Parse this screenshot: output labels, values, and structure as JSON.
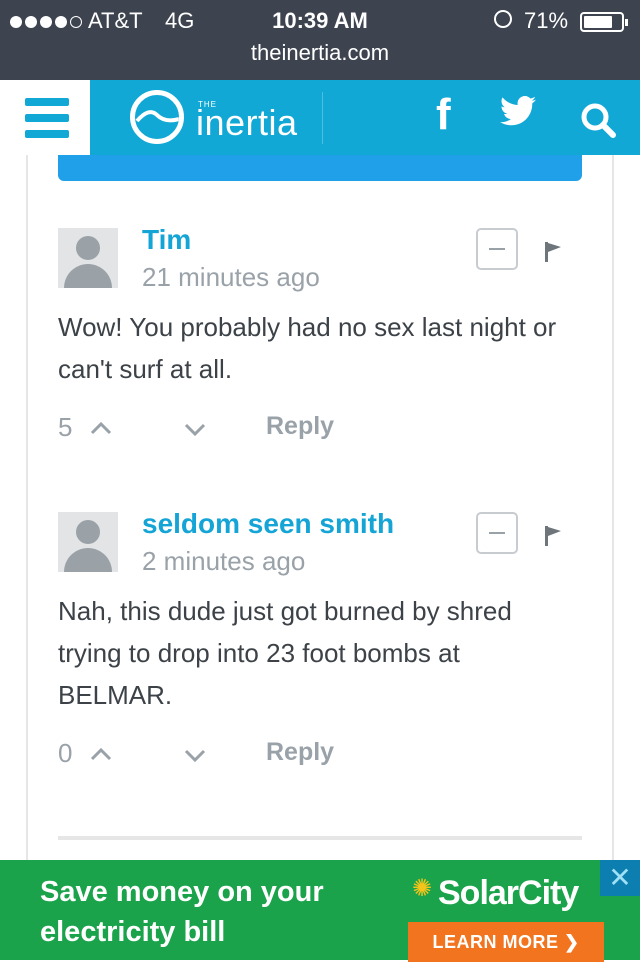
{
  "status_bar": {
    "carrier": "AT&T",
    "network": "4G",
    "time": "10:39 AM",
    "battery_percent": "71%",
    "signal_bars": 4,
    "signal_total": 5,
    "battery_level": 0.71
  },
  "browser": {
    "url": "theinertia.com"
  },
  "header": {
    "logo_small": "THE",
    "logo_text": "inertia",
    "icons": [
      "menu-icon",
      "facebook-icon",
      "twitter-icon",
      "search-icon"
    ],
    "accent_color": "#11a8d6",
    "facebook_glyph": "f"
  },
  "comments": [
    {
      "author": "Tim",
      "time_ago": "21 minutes ago",
      "text": "Wow! You probably had no sex last night or can't surf at all.",
      "votes": "5",
      "reply_label": "Reply"
    },
    {
      "author": "seldom seen smith",
      "time_ago": "2 minutes ago",
      "text": "Nah, this dude just got burned by shred trying to drop into 23 foot bombs at BELMAR.",
      "votes": "0",
      "reply_label": "Reply"
    }
  ],
  "ad": {
    "headline": "Save money on your electricity bill",
    "brand": "SolarCity",
    "cta": "LEARN MORE ❯",
    "close_glyph": "✕",
    "background_color": "#1aa34a",
    "cta_color": "#f2741f"
  }
}
